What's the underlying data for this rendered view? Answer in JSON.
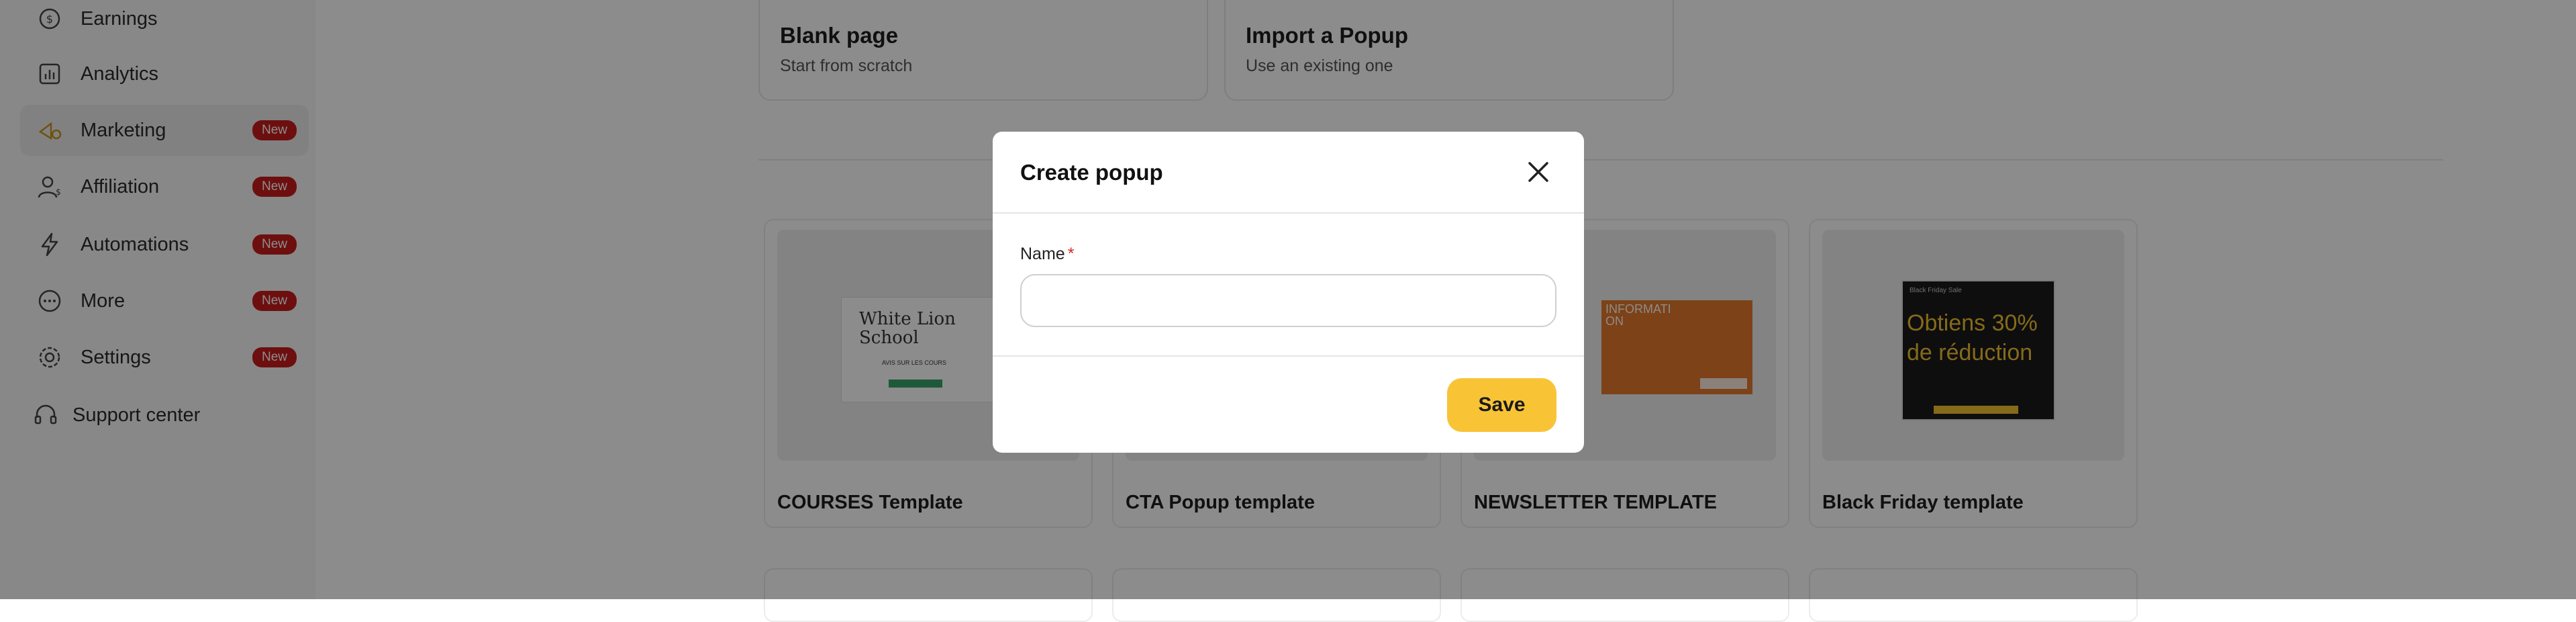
{
  "sidebar": {
    "items": [
      {
        "label": "Earnings",
        "icon": "earnings-icon",
        "badge": ""
      },
      {
        "label": "Analytics",
        "icon": "analytics-icon",
        "badge": ""
      },
      {
        "label": "Marketing",
        "icon": "marketing-icon",
        "badge": "New"
      },
      {
        "label": "Affiliation",
        "icon": "affiliation-icon",
        "badge": "New"
      },
      {
        "label": "Automations",
        "icon": "lightning-icon",
        "badge": "New"
      },
      {
        "label": "More",
        "icon": "more-icon",
        "badge": "New"
      },
      {
        "label": "Settings",
        "icon": "gear-icon",
        "badge": "New"
      },
      {
        "label": "Support center",
        "icon": "headset-icon",
        "badge": ""
      }
    ]
  },
  "start_options": [
    {
      "title": "Blank page",
      "subtitle": "Start from scratch"
    },
    {
      "title": "Import a Popup",
      "subtitle": "Use an existing one"
    }
  ],
  "templates": [
    {
      "title": "COURSES Template",
      "thumb_text": "White Lion School",
      "thumb_sub": "AVIS SUR LES COURS"
    },
    {
      "title": "CTA Popup template"
    },
    {
      "title": "NEWSLETTER TEMPLATE",
      "thumb_text": "INFORMATI ON"
    },
    {
      "title": "Black Friday template",
      "thumb_small": "Black Friday Sale",
      "thumb_text": "Obtiens 30% de réduction"
    }
  ],
  "modal": {
    "title": "Create popup",
    "name_label": "Name",
    "required_mark": "*",
    "name_value": "",
    "save_label": "Save"
  },
  "colors": {
    "accent": "#f8c436",
    "badge": "#c81d1d",
    "required": "#d72b2b"
  }
}
